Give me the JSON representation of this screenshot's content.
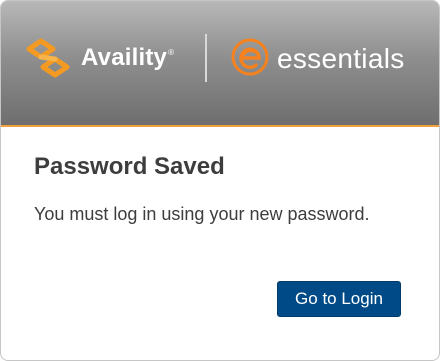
{
  "header": {
    "availity_logo": {
      "text": "Availity",
      "trademark": "®",
      "icon": "availity-logo-icon",
      "color": "#f49a22"
    },
    "essentials_logo": {
      "text": "essentials",
      "icon": "essentials-e-icon",
      "color": "#f5821f"
    },
    "accent_color": "#f0a03a"
  },
  "dialog": {
    "title": "Password Saved",
    "message": "You must log in using your new password.",
    "login_button_label": "Go to Login",
    "button_color": "#004b87"
  }
}
